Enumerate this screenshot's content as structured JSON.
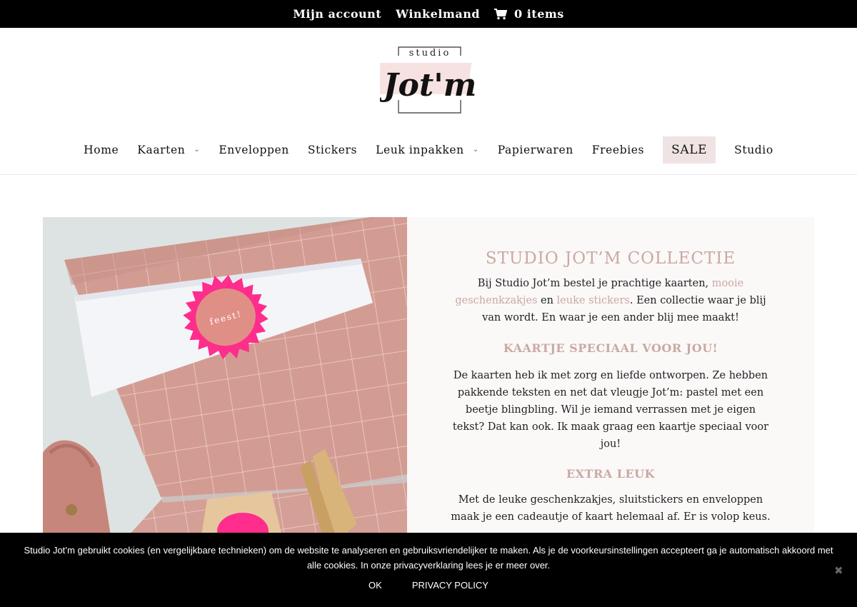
{
  "topbar": {
    "account": "Mijn account",
    "cart": "Winkelmand",
    "items": "0 items"
  },
  "logo": {
    "studio": "studio",
    "name": "Jot'm"
  },
  "nav": {
    "home": "Home",
    "kaarten": "Kaarten",
    "enveloppen": "Enveloppen",
    "stickers": "Stickers",
    "inpakken": "Leuk inpakken",
    "papierwaren": "Papierwaren",
    "freebies": "Freebies",
    "sale": "SALE",
    "studio": "Studio"
  },
  "hero": {
    "sticker_text": "feest!"
  },
  "content": {
    "title": "STUDIO JOT’M COLLECTIE",
    "intro_1": "Bij Studio Jot’m bestel je prachtige kaarten, ",
    "intro_link_1": "mooie geschenkzakjes",
    "intro_2": " en ",
    "intro_link_2": "leuke stickers",
    "intro_3": ". Een collectie waar je blij van wordt. En waar je een ander blij mee maakt!",
    "heading_2": "KAARTJE SPECIAAL VOOR JOU!",
    "para_2": "De kaarten heb ik met zorg en liefde ontworpen. Ze hebben pakkende teksten en net dat vleugje Jot’m: pastel met een beetje blingbling. Wil je iemand verrassen met je eigen tekst? Dat kan ook. Ik maak graag een kaartje speciaal voor jou!",
    "heading_3": "EXTRA LEUK",
    "para_3": "Met de leuke geschenkzakjes, sluitstickers en enveloppen maak je een cadeautje of kaart helemaal af. Er is volop keus."
  },
  "cookie": {
    "message": "Studio Jot’m gebruikt cookies (en vergelijkbare technieken) om de website te analyseren en gebruiksvriendelijker te maken. Als je de voorkeursinstellingen accepteert ga je automatisch akkoord met alle cookies. In onze privacyverklaring lees je er meer over.",
    "ok": "OK",
    "policy": "PRIVACY POLICY",
    "close": "✖"
  },
  "colors": {
    "accent": "#c9a9a2",
    "sale_bg": "#f0e3e3",
    "panel_bg": "#fbf8f8",
    "bag": "#d39c93",
    "sticker": "#ff2d8c"
  }
}
